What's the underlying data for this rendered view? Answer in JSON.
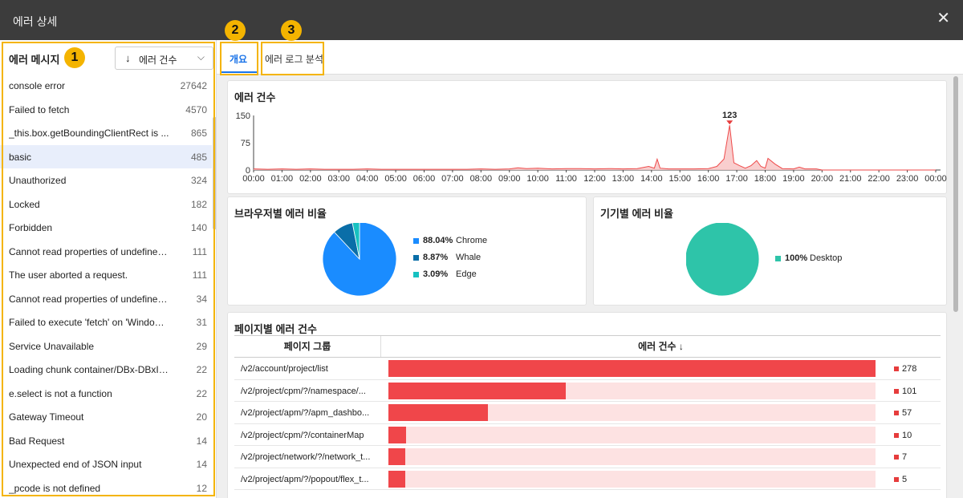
{
  "window": {
    "title": "에러 상세",
    "close_icon": "close-icon"
  },
  "badges": [
    "1",
    "2",
    "3"
  ],
  "left": {
    "header_label": "에러 메시지",
    "sort_label": "에러 건수",
    "sort_icon": "arrow-down-icon",
    "dropdown_icon": "chevron-down-icon",
    "selected_index": 3,
    "errors": [
      {
        "name": "console error",
        "count": "27642"
      },
      {
        "name": "Failed to fetch",
        "count": "4570"
      },
      {
        "name": "_this.box.getBoundingClientRect is ...",
        "count": "865"
      },
      {
        "name": "basic",
        "count": "485"
      },
      {
        "name": "Unauthorized",
        "count": "324"
      },
      {
        "name": "Locked",
        "count": "182"
      },
      {
        "name": "Forbidden",
        "count": "140"
      },
      {
        "name": "Cannot read properties of undefined...",
        "count": "111"
      },
      {
        "name": "The user aborted a request.",
        "count": "111"
      },
      {
        "name": "Cannot read properties of undefined...",
        "count": "34"
      },
      {
        "name": "Failed to execute 'fetch' on 'Window'...",
        "count": "31"
      },
      {
        "name": "Service Unavailable",
        "count": "29"
      },
      {
        "name": "Loading chunk container/DBx-DBxIn...",
        "count": "22"
      },
      {
        "name": "e.select is not a function",
        "count": "22"
      },
      {
        "name": "Gateway Timeout",
        "count": "20"
      },
      {
        "name": "Bad Request",
        "count": "14"
      },
      {
        "name": "Unexpected end of JSON input",
        "count": "14"
      },
      {
        "name": "_pcode is not defined",
        "count": "12"
      }
    ]
  },
  "tabs": [
    {
      "label": "개요",
      "active": true
    },
    {
      "label": "에러 로그 분석",
      "active": false
    }
  ],
  "error_count_card": {
    "title": "에러 건수",
    "peak_label": "123",
    "yticks": [
      "150",
      "75",
      "0"
    ],
    "xticks": [
      "00:00",
      "01:00",
      "02:00",
      "03:00",
      "04:00",
      "05:00",
      "06:00",
      "07:00",
      "08:00",
      "09:00",
      "10:00",
      "11:00",
      "12:00",
      "13:00",
      "14:00",
      "15:00",
      "16:00",
      "17:00",
      "18:00",
      "19:00",
      "20:00",
      "21:00",
      "22:00",
      "23:00",
      "00:00"
    ]
  },
  "browser_card": {
    "title": "브라우저별 에러 비율",
    "items": [
      {
        "pct": "88.04%",
        "name": "Chrome",
        "color": "#1a8cff",
        "value": 88.04
      },
      {
        "pct": "8.87%",
        "name": "Whale",
        "color": "#0a6ea8",
        "value": 8.87
      },
      {
        "pct": "3.09%",
        "name": "Edge",
        "color": "#17c1c1",
        "value": 3.09
      }
    ]
  },
  "device_card": {
    "title": "기기별 에러 비율",
    "items": [
      {
        "pct": "100%",
        "name": "Desktop",
        "color": "#2ec4a9",
        "value": 100
      }
    ]
  },
  "page_card": {
    "title": "페이지별 에러 건수",
    "col_page": "페이지 그룹",
    "col_count": "에러 건수 ↓",
    "max": 278,
    "rows": [
      {
        "page": "/v2/account/project/list",
        "value": "278",
        "n": 278
      },
      {
        "page": "/v2/project/cpm/?/namespace/...",
        "value": "101",
        "n": 101
      },
      {
        "page": "/v2/project/apm/?/apm_dashbo...",
        "value": "57",
        "n": 57
      },
      {
        "page": "/v2/project/cpm/?/containerMap",
        "value": "10",
        "n": 10
      },
      {
        "page": "/v2/project/network/?/network_t...",
        "value": "7",
        "n": 7
      },
      {
        "page": "/v2/project/apm/?/popout/flex_t...",
        "value": "5",
        "n": 5
      }
    ]
  },
  "chart_data": [
    {
      "type": "area",
      "title": "에러 건수",
      "xlabel": "",
      "ylabel": "",
      "ylim": [
        0,
        150
      ],
      "x": [
        "00:00",
        "01:00",
        "02:00",
        "03:00",
        "04:00",
        "05:00",
        "06:00",
        "07:00",
        "08:00",
        "09:00",
        "10:00",
        "11:00",
        "12:00",
        "13:00",
        "14:00",
        "15:00",
        "16:00",
        "17:00",
        "18:00",
        "19:00",
        "20:00",
        "21:00",
        "22:00",
        "23:00",
        "00:00"
      ],
      "annotations": [
        {
          "text": "123",
          "x": "16:45",
          "y": 123
        }
      ],
      "points": [
        [
          0,
          3
        ],
        [
          0.5,
          2
        ],
        [
          1,
          3
        ],
        [
          1.5,
          2
        ],
        [
          2,
          3
        ],
        [
          2.5,
          2
        ],
        [
          3,
          2
        ],
        [
          3.5,
          2
        ],
        [
          4,
          3
        ],
        [
          4.5,
          2
        ],
        [
          5,
          2
        ],
        [
          5.5,
          2
        ],
        [
          6,
          2
        ],
        [
          6.5,
          2
        ],
        [
          7,
          2
        ],
        [
          7.5,
          2
        ],
        [
          8,
          3
        ],
        [
          8.5,
          2
        ],
        [
          9,
          3
        ],
        [
          9.3,
          6
        ],
        [
          9.6,
          4
        ],
        [
          10,
          5
        ],
        [
          10.5,
          3
        ],
        [
          11,
          4
        ],
        [
          11.5,
          4
        ],
        [
          12,
          3
        ],
        [
          12.5,
          4
        ],
        [
          13,
          3
        ],
        [
          13.5,
          4
        ],
        [
          13.9,
          10
        ],
        [
          14.1,
          5
        ],
        [
          14.2,
          30
        ],
        [
          14.3,
          5
        ],
        [
          14.6,
          3
        ],
        [
          15,
          3
        ],
        [
          15.5,
          3
        ],
        [
          16,
          4
        ],
        [
          16.3,
          10
        ],
        [
          16.55,
          30
        ],
        [
          16.75,
          123
        ],
        [
          16.9,
          20
        ],
        [
          17.1,
          12
        ],
        [
          17.3,
          5
        ],
        [
          17.5,
          12
        ],
        [
          17.7,
          26
        ],
        [
          17.85,
          10
        ],
        [
          18,
          5
        ],
        [
          18.1,
          32
        ],
        [
          18.35,
          16
        ],
        [
          18.6,
          4
        ],
        [
          19,
          3
        ],
        [
          19.2,
          8
        ],
        [
          19.4,
          3
        ],
        [
          19.8,
          3
        ],
        [
          20,
          0
        ],
        [
          24,
          0
        ]
      ]
    },
    {
      "type": "pie",
      "title": "브라우저별 에러 비율",
      "categories": [
        "Chrome",
        "Whale",
        "Edge"
      ],
      "values": [
        88.04,
        8.87,
        3.09
      ]
    },
    {
      "type": "pie",
      "title": "기기별 에러 비율",
      "categories": [
        "Desktop"
      ],
      "values": [
        100
      ]
    },
    {
      "type": "bar",
      "title": "페이지별 에러 건수",
      "categories": [
        "/v2/account/project/list",
        "/v2/project/cpm/?/namespace/...",
        "/v2/project/apm/?/apm_dashbo...",
        "/v2/project/cpm/?/containerMap",
        "/v2/project/network/?/network_t...",
        "/v2/project/apm/?/popout/flex_t..."
      ],
      "values": [
        278,
        101,
        57,
        10,
        7,
        5
      ]
    }
  ]
}
